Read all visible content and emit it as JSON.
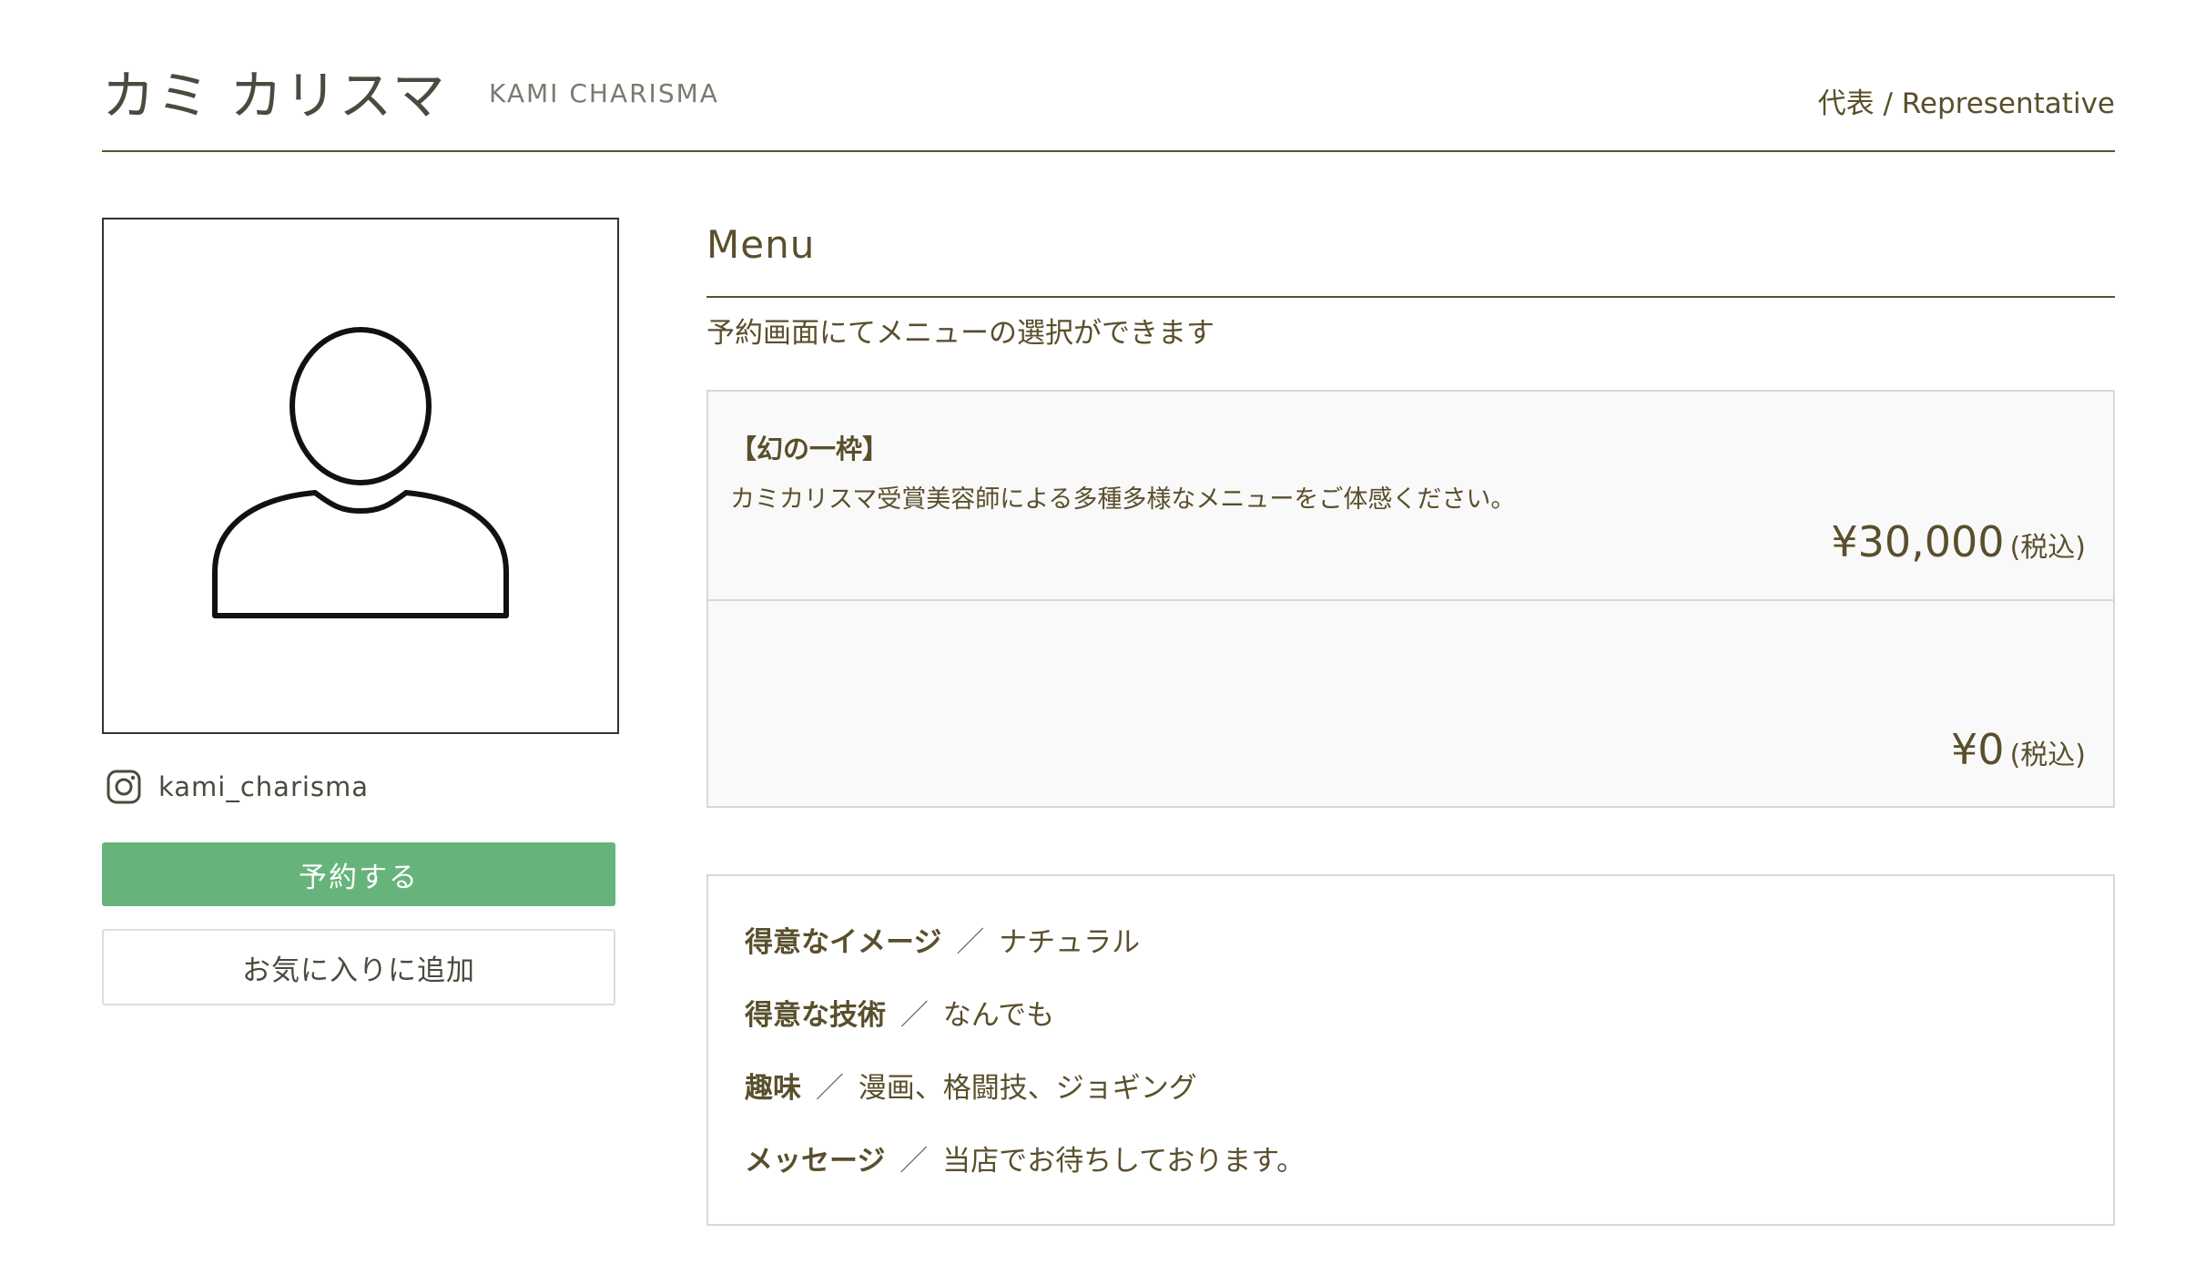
{
  "header": {
    "name_ja": "カミ  カリスマ",
    "name_en": "KAMI CHARISMA",
    "role": "代表 / Representative"
  },
  "profile": {
    "avatar_icon": "user-silhouette-icon",
    "instagram_icon": "instagram-icon",
    "instagram_handle": "kami_charisma"
  },
  "actions": {
    "reserve_label": "予約する",
    "favorite_label": "お気に入りに追加",
    "reserve_color": "#66b47c"
  },
  "menu": {
    "title": "Menu",
    "subtitle": "予約画面にてメニューの選択ができます",
    "items": [
      {
        "title": "【幻の一枠】",
        "description": "カミカリスマ受賞美容師による多種多様なメニューをご体感ください。",
        "price": "¥30,000",
        "tax": "(税込)"
      },
      {
        "title": "",
        "description": "",
        "price": "¥0",
        "tax": "(税込)"
      }
    ]
  },
  "details": [
    {
      "label": "得意なイメージ",
      "sep": "／",
      "value": "ナチュラル"
    },
    {
      "label": "得意な技術",
      "sep": "／",
      "value": "なんでも"
    },
    {
      "label": "趣味",
      "sep": "／",
      "value": "漫画、格闘技、ジョギング"
    },
    {
      "label": "メッセージ",
      "sep": "／",
      "value": "当店でお待ちしております。"
    }
  ]
}
